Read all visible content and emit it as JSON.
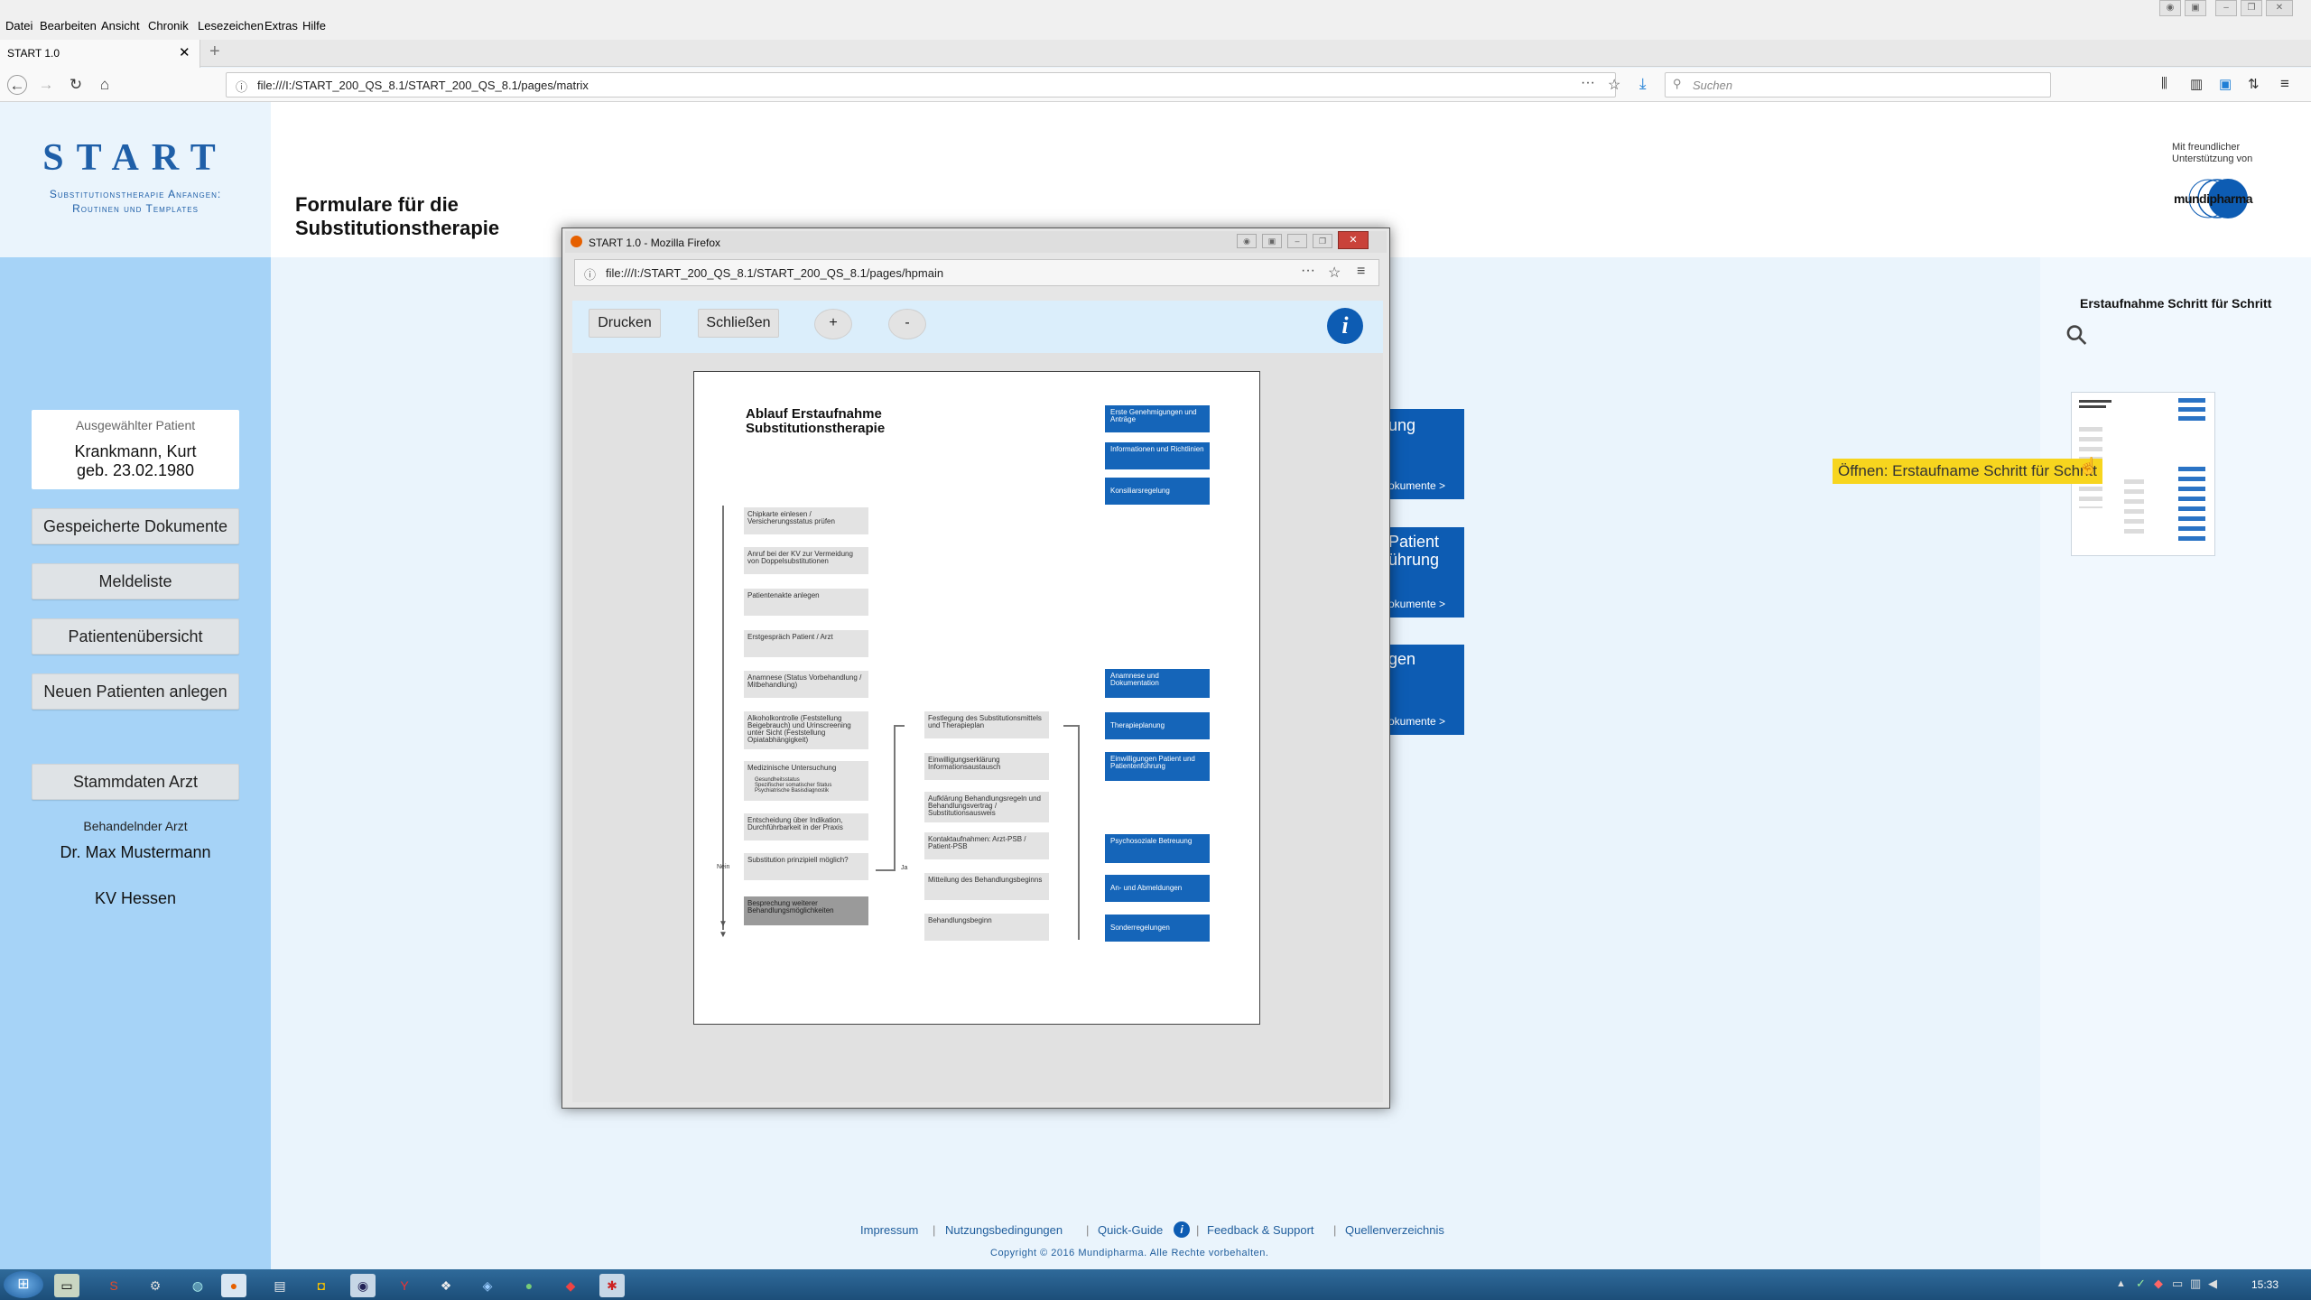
{
  "menubar": {
    "items": [
      "Datei",
      "Bearbeiten",
      "Ansicht",
      "Chronik",
      "Lesezeichen",
      "Extras",
      "Hilfe"
    ]
  },
  "tab": {
    "title": "START 1.0"
  },
  "url": "file:///I:/START_200_QS_8.1/START_200_QS_8.1/pages/matrix",
  "search_placeholder": "Suchen",
  "logo": {
    "title": "START",
    "subtitle_line1": "Substitutionstherapie Anfangen:",
    "subtitle_line2": "Routinen und Templates"
  },
  "page_title_line1": "Formulare für die",
  "page_title_line2": "Substitutionstherapie",
  "sponsor": {
    "line1": "Mit freundlicher",
    "line2": "Unterstützung von",
    "brand": "mundipharma"
  },
  "patient": {
    "label": "Ausgewählter Patient",
    "name": "Krankmann, Kurt",
    "dob": "geb. 23.02.1980"
  },
  "sidebar": {
    "buttons": [
      "Gespeicherte Dokumente",
      "Meldeliste",
      "Patientenübersicht",
      "Neuen Patienten anlegen"
    ],
    "stammdaten": "Stammdaten Arzt",
    "arzt_label": "Behandelnder Arzt",
    "arzt_name": "Dr. Max Mustermann",
    "kv": "KV Hessen"
  },
  "cards": [
    {
      "title": "ung",
      "link": "okumente >"
    },
    {
      "title1": "Patient",
      "title2": "ührung",
      "link": "okumente >"
    },
    {
      "title": "gen",
      "link": "okumente >"
    }
  ],
  "right_panel": {
    "title": "Erstaufnahme Schritt für Schritt",
    "tooltip": "Öffnen: Erstaufname Schritt für Schritt"
  },
  "popup": {
    "title": "START 1.0 - Mozilla Firefox",
    "url": "file:///I:/START_200_QS_8.1/START_200_QS_8.1/pages/hpmain",
    "buttons": {
      "print": "Drucken",
      "close": "Schließen",
      "plus": "+",
      "minus": "-"
    }
  },
  "document": {
    "title_line1": "Ablauf Erstaufnahme",
    "title_line2": "Substitutionstherapie",
    "left_steps": [
      "Chipkarte einlesen / Versicherungsstatus prüfen",
      "Anruf bei der KV zur Vermeidung von Doppelsubstitutionen",
      "Patientenakte anlegen",
      "Erstgespräch Patient / Arzt",
      "Anamnese (Status Vorbehandlung / Mitbehandlung)",
      "Alkoholkontrolle (Feststellung Beigebrauch) und Urinscreening unter Sicht (Feststellung Opiatabhängigkeit)",
      "Medizinische Untersuchung",
      "Entscheidung über Indikation, Durchführbarkeit in der Praxis",
      "Substitution prinzipiell möglich?",
      "Besprechung weiterer Behandlungsmöglichkeiten"
    ],
    "med_sub": [
      "Gesundheitsstatus",
      "Spezifischer somatischer Status",
      "Psychiatrische Basisdiagnostik"
    ],
    "nein": "Nein",
    "ja": "Ja",
    "mid_steps": [
      "Festlegung des Substitutionsmittels und Therapieplan",
      "Einwilligungserklärung Informationsaustausch",
      "Aufklärung Behandlungsregeln und Behandlungsvertrag / Substitutionsausweis",
      "Kontaktaufnahmen: Arzt-PSB / Patient-PSB",
      "Mitteilung des Behandlungsbeginns",
      "Behandlungsbeginn"
    ],
    "right_boxes": [
      "Erste Genehmigungen und Anträge",
      "Informationen und Richtlinien",
      "Konsiliarsregelung",
      "Anamnese und Dokumentation",
      "Therapieplanung",
      "Einwilligungen Patient und Patientenführung",
      "Psychosoziale Betreuung",
      "An- und Abmeldungen",
      "Sonderregelungen"
    ]
  },
  "footer": {
    "links": [
      "Impressum",
      "Nutzungsbedingungen",
      "Quick-Guide",
      "Feedback & Support",
      "Quellenverzeichnis"
    ],
    "copyright": "Copyright © 2016 Mundipharma. Alle Rechte vorbehalten."
  },
  "taskbar": {
    "clock": "15:33"
  }
}
